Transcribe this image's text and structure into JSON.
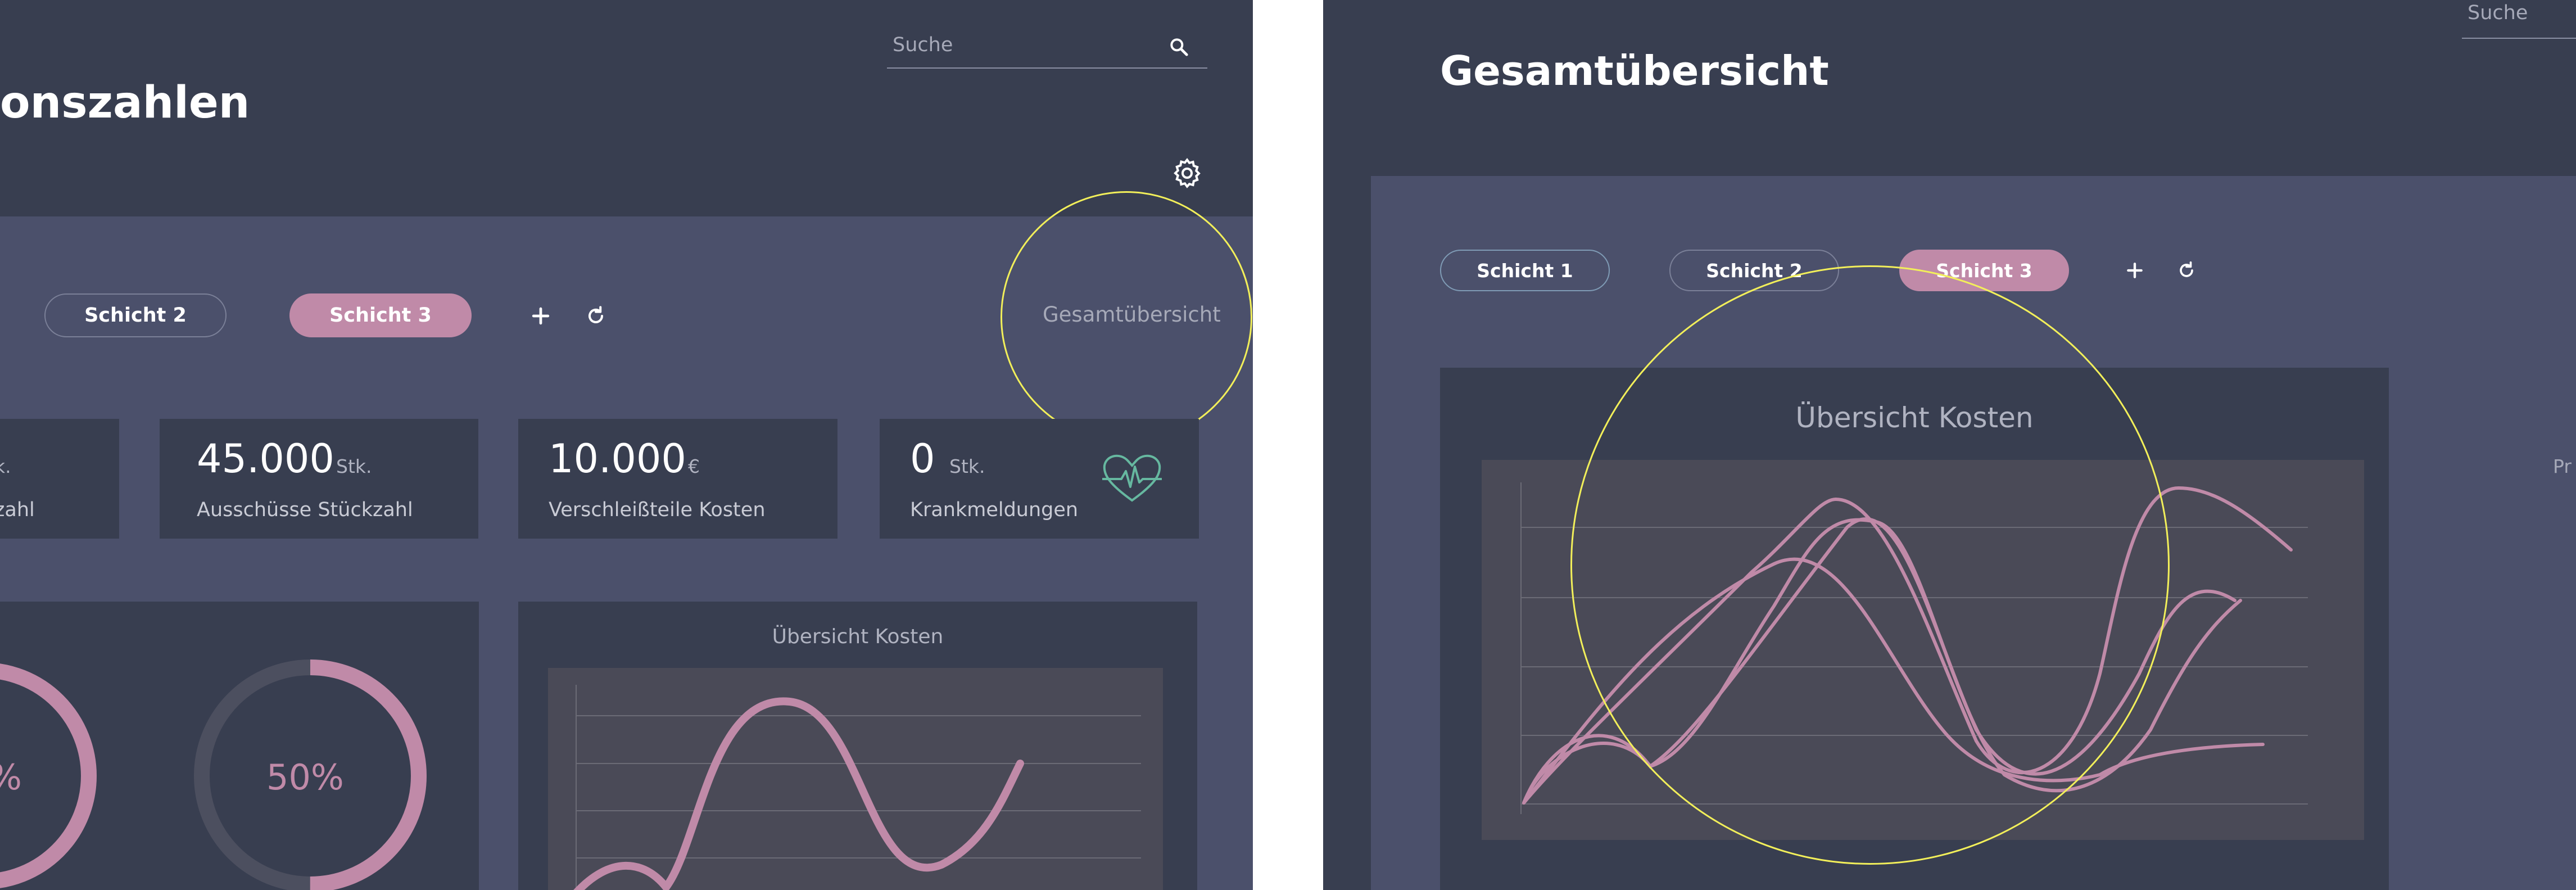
{
  "left_screen": {
    "page_title": "onszahlen",
    "search": {
      "placeholder": "Suche",
      "icon": "search-icon"
    },
    "settings_icon": "gear-icon",
    "tabs": [
      {
        "label": "Schicht 2",
        "state": "outline"
      },
      {
        "label": "Schicht 3",
        "state": "active"
      }
    ],
    "add_icon": "plus-icon",
    "refresh_icon": "refresh-icon",
    "overview_link": "Gesamtübersicht",
    "kpis": [
      {
        "value": "",
        "unit": "k.",
        "label": "zahl"
      },
      {
        "value": "45.000",
        "unit": "Stk.",
        "label": "Ausschüsse Stückzahl"
      },
      {
        "value": "10.000",
        "unit": "€",
        "label": "Verschleißteile Kosten"
      },
      {
        "value": "0",
        "unit": "Stk.",
        "label": "Krankmeldungen",
        "icon": "heart-pulse-icon"
      }
    ],
    "donuts": [
      {
        "label": "%",
        "percent": 50
      },
      {
        "label": "50%",
        "percent": 50
      }
    ],
    "cost_chart": {
      "title": "Übersicht Kosten"
    }
  },
  "right_screen": {
    "page_title": "Gesamtübersicht",
    "search": {
      "placeholder": "Suche"
    },
    "tabs": [
      {
        "label": "Schicht 1",
        "state": "outline-blue"
      },
      {
        "label": "Schicht 2",
        "state": "outline"
      },
      {
        "label": "Schicht 3",
        "state": "active"
      }
    ],
    "add_icon": "plus-icon",
    "refresh_icon": "refresh-icon",
    "cost_chart": {
      "title": "Übersicht Kosten"
    },
    "side_label": "Pr"
  },
  "colors": {
    "header_bg": "#383e50",
    "content_bg": "#4b506b",
    "card_bg": "#383e50",
    "plot_bg": "#4a4a57",
    "accent_pink": "#c08aa8",
    "highlight_yellow": "#f2ef5a",
    "heart_green": "#66b8a0"
  }
}
